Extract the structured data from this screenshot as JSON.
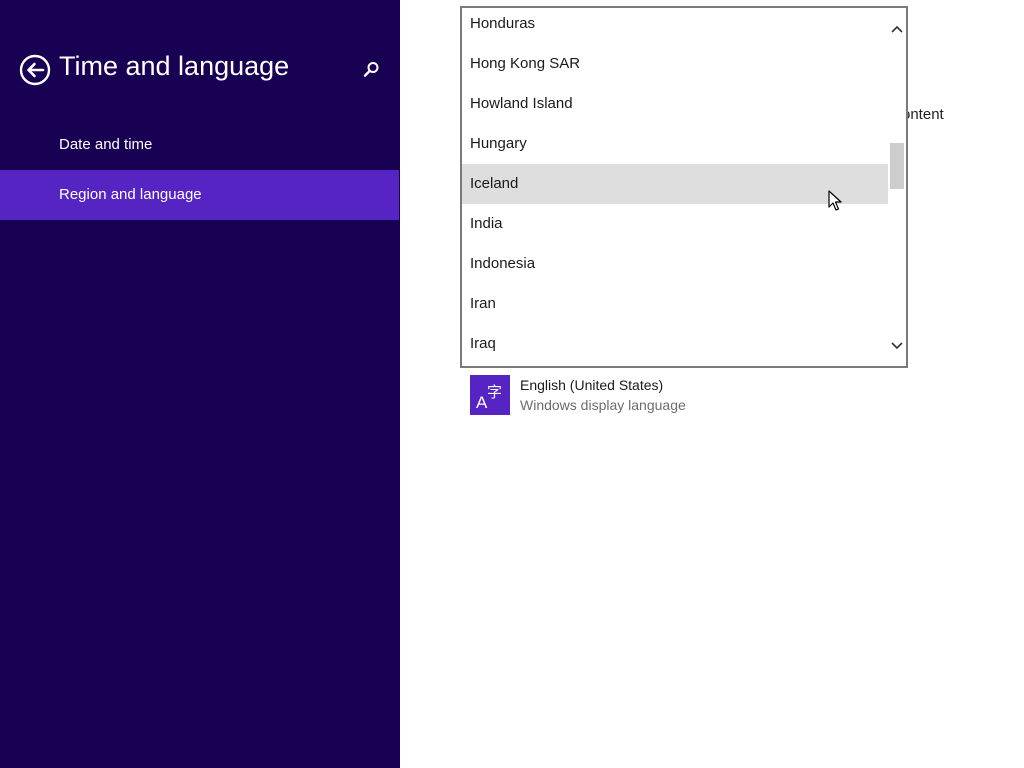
{
  "header": {
    "title": "Time and language"
  },
  "nav": {
    "items": [
      {
        "label": "Date and time"
      },
      {
        "label": "Region and language"
      }
    ],
    "selected": "Region and language"
  },
  "country_dropdown": {
    "items": [
      "Honduras",
      "Hong Kong SAR",
      "Howland Island",
      "Hungary",
      "Iceland",
      "India",
      "Indonesia",
      "Iran",
      "Iraq"
    ],
    "hovered": "Iceland"
  },
  "partial_background_text": "ontent",
  "language": {
    "name": "English (United States)",
    "description": "Windows display language",
    "icon_text": "A字"
  },
  "icons": {
    "back": "back-arrow-icon",
    "search": "search-icon",
    "scroll_up": "chevron-up-icon",
    "scroll_down": "chevron-down-icon",
    "language": "language-icon"
  },
  "colors": {
    "left_pane": "#180052",
    "accent": "#5524c2",
    "hover": "#dedede"
  }
}
